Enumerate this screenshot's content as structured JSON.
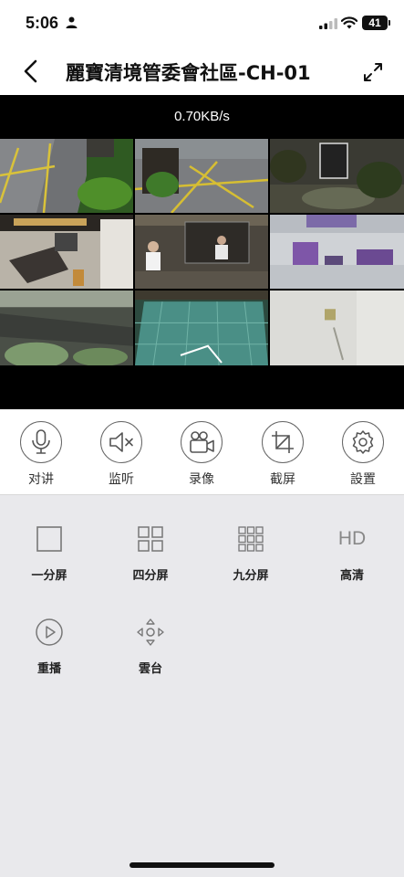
{
  "status_bar": {
    "time": "5:06",
    "battery": "41",
    "icons": [
      "person-icon",
      "signal-icon",
      "wifi-icon",
      "battery-icon"
    ]
  },
  "nav": {
    "title": "麗寶清境管委會社區-CH-01",
    "back_icon": "chevron-left-icon",
    "fullscreen_icon": "expand-icon"
  },
  "video": {
    "speed": "0.70KB/s",
    "cameras": 9
  },
  "controls": [
    {
      "label": "对讲",
      "icon": "microphone-icon"
    },
    {
      "label": "监听",
      "icon": "speaker-mute-icon"
    },
    {
      "label": "录像",
      "icon": "video-camera-icon"
    },
    {
      "label": "截屏",
      "icon": "crop-icon"
    },
    {
      "label": "設置",
      "icon": "gear-icon"
    }
  ],
  "layouts": [
    {
      "label": "一分屏",
      "icon": "single-screen-icon"
    },
    {
      "label": "四分屏",
      "icon": "four-screen-icon"
    },
    {
      "label": "九分屏",
      "icon": "nine-screen-icon"
    },
    {
      "label": "高清",
      "icon_text": "HD"
    },
    {
      "label": "重播",
      "icon": "play-circle-icon"
    },
    {
      "label": "雲台",
      "icon": "ptz-icon"
    }
  ],
  "colors": {
    "accent": "#000000",
    "panel_bg": "#e9e9ec",
    "icon_stroke": "#666666"
  }
}
